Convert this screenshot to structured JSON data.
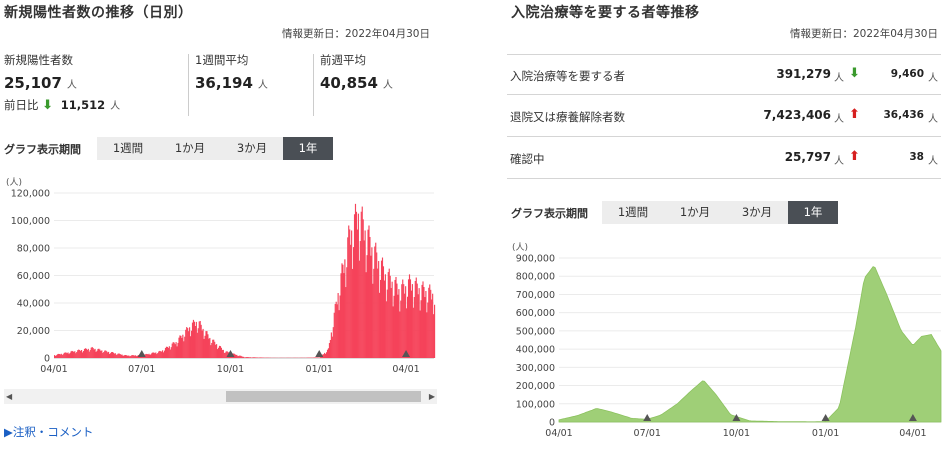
{
  "left": {
    "title": "新規陽性者数の推移（日別）",
    "updated": "情報更新日：2022年04月30日",
    "stats": [
      {
        "label": "新規陽性者数",
        "value": "25,107",
        "unit": "人"
      },
      {
        "label": "1週間平均",
        "value": "36,194",
        "unit": "人"
      },
      {
        "label": "前週平均",
        "value": "40,854",
        "unit": "人"
      }
    ],
    "diff": {
      "label": "前日比",
      "arrow": "⬇",
      "value": "11,512",
      "unit": "人"
    },
    "tabs_label": "グラフ表示期間",
    "tabs": [
      "1週間",
      "1か月",
      "3か月",
      "1年"
    ],
    "active_tab": 3,
    "note": "▶注釈・コメント"
  },
  "right": {
    "title": "入院治療等を要する者等推移",
    "updated": "情報更新日：2022年04月30日",
    "rows": [
      {
        "label": "入院治療等を要する者",
        "value": "391,279",
        "unit": "人",
        "dir": "down",
        "diff": "9,460",
        "diff_unit": "人"
      },
      {
        "label": "退院又は療養解除者数",
        "value": "7,423,406",
        "unit": "人",
        "dir": "up",
        "diff": "36,436",
        "diff_unit": "人"
      },
      {
        "label": "確認中",
        "value": "25,797",
        "unit": "人",
        "dir": "up",
        "diff": "38",
        "diff_unit": "人"
      }
    ],
    "tabs_label": "グラフ表示期間",
    "tabs": [
      "1週間",
      "1か月",
      "3か月",
      "1年"
    ],
    "active_tab": 3
  },
  "colors": {
    "left_series": "#f5435a",
    "right_series": "#9fcf77",
    "tab_active": "#4a4f55",
    "arrow_down": "#3a9a2d",
    "arrow_up": "#d61f1f"
  },
  "icons": {
    "arrow_up": "arrow-up-icon",
    "arrow_down": "arrow-down-icon",
    "scroll_left": "chevron-left-icon",
    "scroll_right": "chevron-right-icon",
    "tick_marker": "triangle-up-icon"
  },
  "chart_data": [
    {
      "type": "bar",
      "ylabel": "(人)",
      "ylim": [
        0,
        120000
      ],
      "yticks": [
        "0",
        "20,000",
        "40,000",
        "60,000",
        "80,000",
        "100,000",
        "120,000"
      ],
      "ytick_values": [
        0,
        20000,
        40000,
        60000,
        80000,
        100000,
        120000
      ],
      "xticks": [
        "04/01",
        "07/01",
        "10/01",
        "01/01",
        "04/01"
      ],
      "x_range": [
        "2021-04-01",
        "2022-04-30"
      ],
      "grid": true,
      "shape_keypoints": {
        "x": [
          "2021-04-01",
          "2021-04-20",
          "2021-05-10",
          "2021-05-25",
          "2021-06-15",
          "2021-07-01",
          "2021-07-20",
          "2021-08-05",
          "2021-08-20",
          "2021-08-27",
          "2021-09-10",
          "2021-09-25",
          "2021-10-15",
          "2021-11-15",
          "2021-12-15",
          "2022-01-01",
          "2022-01-10",
          "2022-01-20",
          "2022-02-01",
          "2022-02-10",
          "2022-02-25",
          "2022-03-10",
          "2022-03-25",
          "2022-04-05",
          "2022-04-15",
          "2022-04-30"
        ],
        "y": [
          2000,
          4500,
          6800,
          4500,
          1700,
          2000,
          4500,
          11000,
          22000,
          25500,
          13000,
          4500,
          600,
          130,
          180,
          450,
          6000,
          45000,
          85000,
          100000,
          75000,
          58000,
          47000,
          52000,
          48000,
          44000
        ]
      }
    },
    {
      "type": "area",
      "ylabel": "(人)",
      "ylim": [
        0,
        900000
      ],
      "yticks": [
        "0",
        "100,000",
        "200,000",
        "300,000",
        "400,000",
        "500,000",
        "600,000",
        "700,000",
        "800,000",
        "900,000"
      ],
      "ytick_values": [
        0,
        100000,
        200000,
        300000,
        400000,
        500000,
        600000,
        700000,
        800000,
        900000
      ],
      "xticks": [
        "04/01",
        "07/01",
        "10/01",
        "01/01",
        "04/01"
      ],
      "x_range": [
        "2021-04-01",
        "2022-04-30"
      ],
      "grid": true,
      "shape_keypoints": {
        "x": [
          "2021-04-01",
          "2021-04-20",
          "2021-05-10",
          "2021-05-25",
          "2021-06-15",
          "2021-07-01",
          "2021-07-15",
          "2021-08-01",
          "2021-08-15",
          "2021-08-28",
          "2021-09-10",
          "2021-09-25",
          "2021-10-15",
          "2021-11-15",
          "2021-12-20",
          "2022-01-01",
          "2022-01-15",
          "2022-02-01",
          "2022-02-10",
          "2022-02-20",
          "2022-03-05",
          "2022-03-20",
          "2022-04-01",
          "2022-04-10",
          "2022-04-20",
          "2022-04-30"
        ],
        "y": [
          12000,
          35000,
          75000,
          55000,
          20000,
          15000,
          38000,
          100000,
          170000,
          230000,
          150000,
          40000,
          6000,
          2000,
          1200,
          3000,
          80000,
          520000,
          790000,
          860000,
          700000,
          500000,
          420000,
          470000,
          480000,
          390000
        ]
      }
    }
  ]
}
